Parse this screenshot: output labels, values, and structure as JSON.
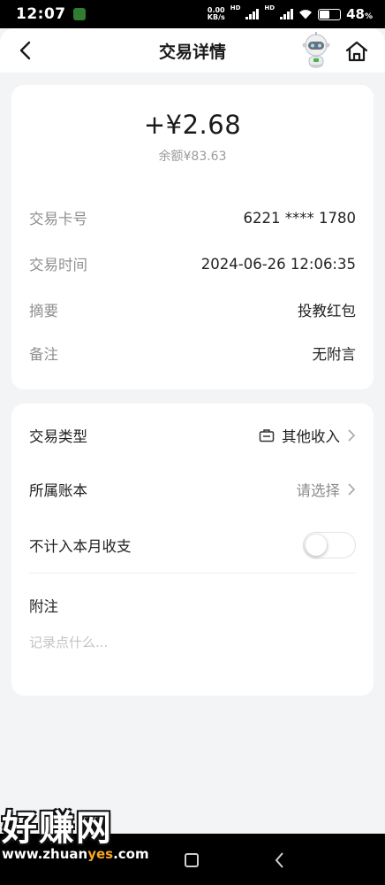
{
  "status_bar": {
    "time": "12:07",
    "net_speed_value": "0.00",
    "net_speed_unit": "KB/s",
    "hd_label": "HD",
    "battery_percent": "48",
    "battery_percent_sign": "%",
    "battery_level": 0.48
  },
  "header": {
    "title": "交易详情",
    "icons": [
      "back-arrow-icon",
      "robot-assistant-icon",
      "home-icon"
    ]
  },
  "summary": {
    "amount": "+¥2.68",
    "balance": "余额¥83.63"
  },
  "details": [
    {
      "label": "交易卡号",
      "value": "6221 **** 1780"
    },
    {
      "label": "交易时间",
      "value": "2024-06-26 12:06:35"
    },
    {
      "label": "摘要",
      "value": "投教红包"
    },
    {
      "label": "备注",
      "value": "无附言"
    }
  ],
  "settings": {
    "type": {
      "label": "交易类型",
      "value": "其他收入",
      "icon": "category-icon"
    },
    "ledger": {
      "label": "所属账本",
      "value": "请选择"
    },
    "exclude": {
      "label": "不计入本月收支",
      "enabled": false
    },
    "note": {
      "label": "附注",
      "placeholder": "记录点什么..."
    }
  },
  "watermark": {
    "big": "好赚网",
    "domain_prefix": "www.zhuan",
    "domain_highlight": "yes",
    "domain_suffix": ".com"
  },
  "colors": {
    "background": "#f3f4f6",
    "card": "#ffffff",
    "label_gray": "#8f8f8f",
    "watermark_accent": "#f5a623"
  }
}
